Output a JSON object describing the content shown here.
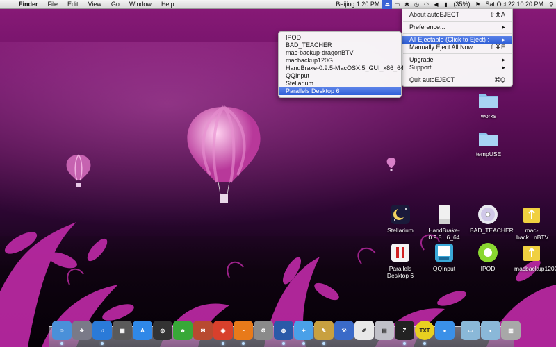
{
  "menubar": {
    "apple_glyph": "",
    "items": [
      "Finder",
      "File",
      "Edit",
      "View",
      "Go",
      "Window",
      "Help"
    ],
    "clock_city": "Beijing 1:20 PM",
    "battery": "(35%)",
    "flag_icon": "us-flag-icon",
    "datetime": "Sat Oct 22  10:20 PM",
    "search_icon": "spotlight-icon"
  },
  "autoeject_menu": {
    "items": [
      {
        "label": "About autoEJECT",
        "shortcut": "⇧⌘A"
      },
      {
        "label": "Preference...",
        "shortcut": "▸"
      },
      {
        "label": "All Ejectable (Click to Eject) :",
        "shortcut": "▸"
      },
      {
        "label": "Manually Eject All Now",
        "shortcut": "⇧⌘E"
      },
      {
        "label": "Upgrade",
        "shortcut": "▸"
      },
      {
        "label": "Support",
        "shortcut": "▸"
      },
      {
        "label": "Quit autoEJECT",
        "shortcut": "⌘Q"
      }
    ]
  },
  "ejectable_submenu": {
    "items": [
      "IPOD",
      "BAD_TEACHER",
      "mac-backup-dragonBTV",
      "macbackup120G",
      "HandBrake-0.9.5-MacOSX.5_GUI_x86_64",
      "QQInput",
      "Stellarium",
      "Parallels Desktop 6"
    ]
  },
  "desktop_icons": [
    {
      "label": "works",
      "icon": "folder-icon"
    },
    {
      "label": "tempUSE",
      "icon": "folder-icon"
    },
    {
      "label": "Stellarium",
      "icon": "stellarium-icon"
    },
    {
      "label": "HandBrake-0.9.5...6_64",
      "icon": "disk-image-icon"
    },
    {
      "label": "BAD_TEACHER",
      "icon": "dvd-icon"
    },
    {
      "label": "mac-back...nBTV",
      "icon": "usb-drive-icon"
    },
    {
      "label": "Parallels Desktop 6",
      "icon": "parallels-icon"
    },
    {
      "label": "QQInput",
      "icon": "qqinput-icon"
    },
    {
      "label": "IPOD",
      "icon": "ipod-icon"
    },
    {
      "label": "macbackup120G",
      "icon": "usb-drive-icon"
    }
  ],
  "dock": {
    "items": [
      {
        "name": "finder-icon",
        "color": "#4a90d9",
        "glyph": "☺"
      },
      {
        "name": "launchpad-icon",
        "color": "#7a7a88",
        "glyph": "✈"
      },
      {
        "name": "itunes-icon",
        "color": "#2a7ad8",
        "glyph": "♫"
      },
      {
        "name": "photo-browser-icon",
        "color": "#5a5a5a",
        "glyph": "▦"
      },
      {
        "name": "app-store-icon",
        "color": "#2f88e8",
        "glyph": "A"
      },
      {
        "name": "dashboard-icon",
        "color": "#333333",
        "glyph": "◎"
      },
      {
        "name": "messenger-icon",
        "color": "#38a838",
        "glyph": "☻"
      },
      {
        "name": "address-book-icon",
        "color": "#b84a30",
        "glyph": "✉"
      },
      {
        "name": "chrome-icon",
        "color": "#d8402c",
        "glyph": "◉"
      },
      {
        "name": "firefox-icon",
        "color": "#e87a1a",
        "glyph": "◔"
      },
      {
        "name": "system-preferences-icon",
        "color": "#8a8a8a",
        "glyph": "⚙"
      },
      {
        "name": "google-earth-icon",
        "color": "#2a5aa8",
        "glyph": "◍"
      },
      {
        "name": "safari-icon",
        "color": "#4aa0e8",
        "glyph": "✦"
      },
      {
        "name": "script-editor-icon",
        "color": "#c8a040",
        "glyph": "✎"
      },
      {
        "name": "xcode-icon",
        "color": "#3a6ac8",
        "glyph": "⚒"
      },
      {
        "name": "textedit-icon",
        "color": "#e8e8e8",
        "glyph": "✐"
      },
      {
        "name": "preview-icon",
        "color": "#c0c0c8",
        "glyph": "▤"
      },
      {
        "name": "zipeg-icon",
        "color": "#222222",
        "glyph": "Z"
      },
      {
        "name": "txt-icon",
        "color": "#e8d020",
        "glyph": "TXT"
      },
      {
        "name": "drop-icon",
        "color": "#3a90e8",
        "glyph": "●"
      },
      {
        "name": "downloads-folder-icon",
        "color": "#8ab8d8",
        "glyph": "▭"
      },
      {
        "name": "documents-folder-icon",
        "color": "#8ab8d8",
        "glyph": "◐"
      },
      {
        "name": "trash-icon",
        "color": "#a8a8a8",
        "glyph": "▥"
      }
    ]
  }
}
